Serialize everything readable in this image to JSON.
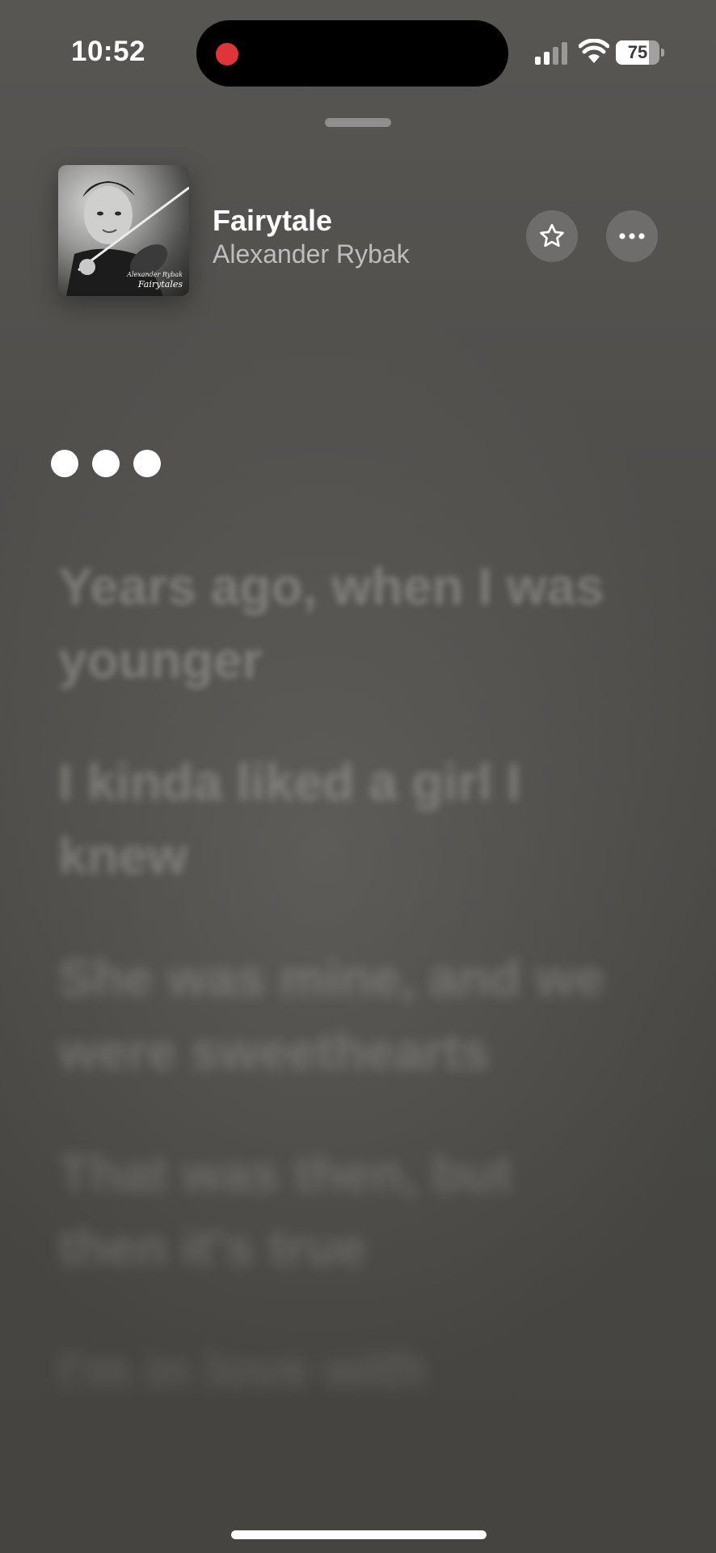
{
  "status_bar": {
    "time": "10:52",
    "battery_level": "75",
    "battery_fraction": 0.75,
    "icons": [
      "recording-indicator-icon",
      "cellular-signal-icon",
      "wifi-icon",
      "battery-icon"
    ]
  },
  "now_playing": {
    "title": "Fairytale",
    "artist": "Alexander Rybak",
    "album_art_text": {
      "artist": "Alexander Rybak",
      "album": "Fairytales"
    },
    "actions": {
      "favorite_icon": "star-icon",
      "more_icon": "ellipsis-icon"
    }
  },
  "interlude_indicator": "three-dot-icon",
  "lyrics": [
    "Years ago, when I was younger",
    "I kinda liked a girl I knew",
    "She was mine, and we were sweethearts",
    "That was then, but then it's true",
    "I'm in love with"
  ],
  "colors": {
    "background": "#4e4d4a",
    "record_dot": "#e0343b",
    "text_primary": "#ffffff"
  }
}
